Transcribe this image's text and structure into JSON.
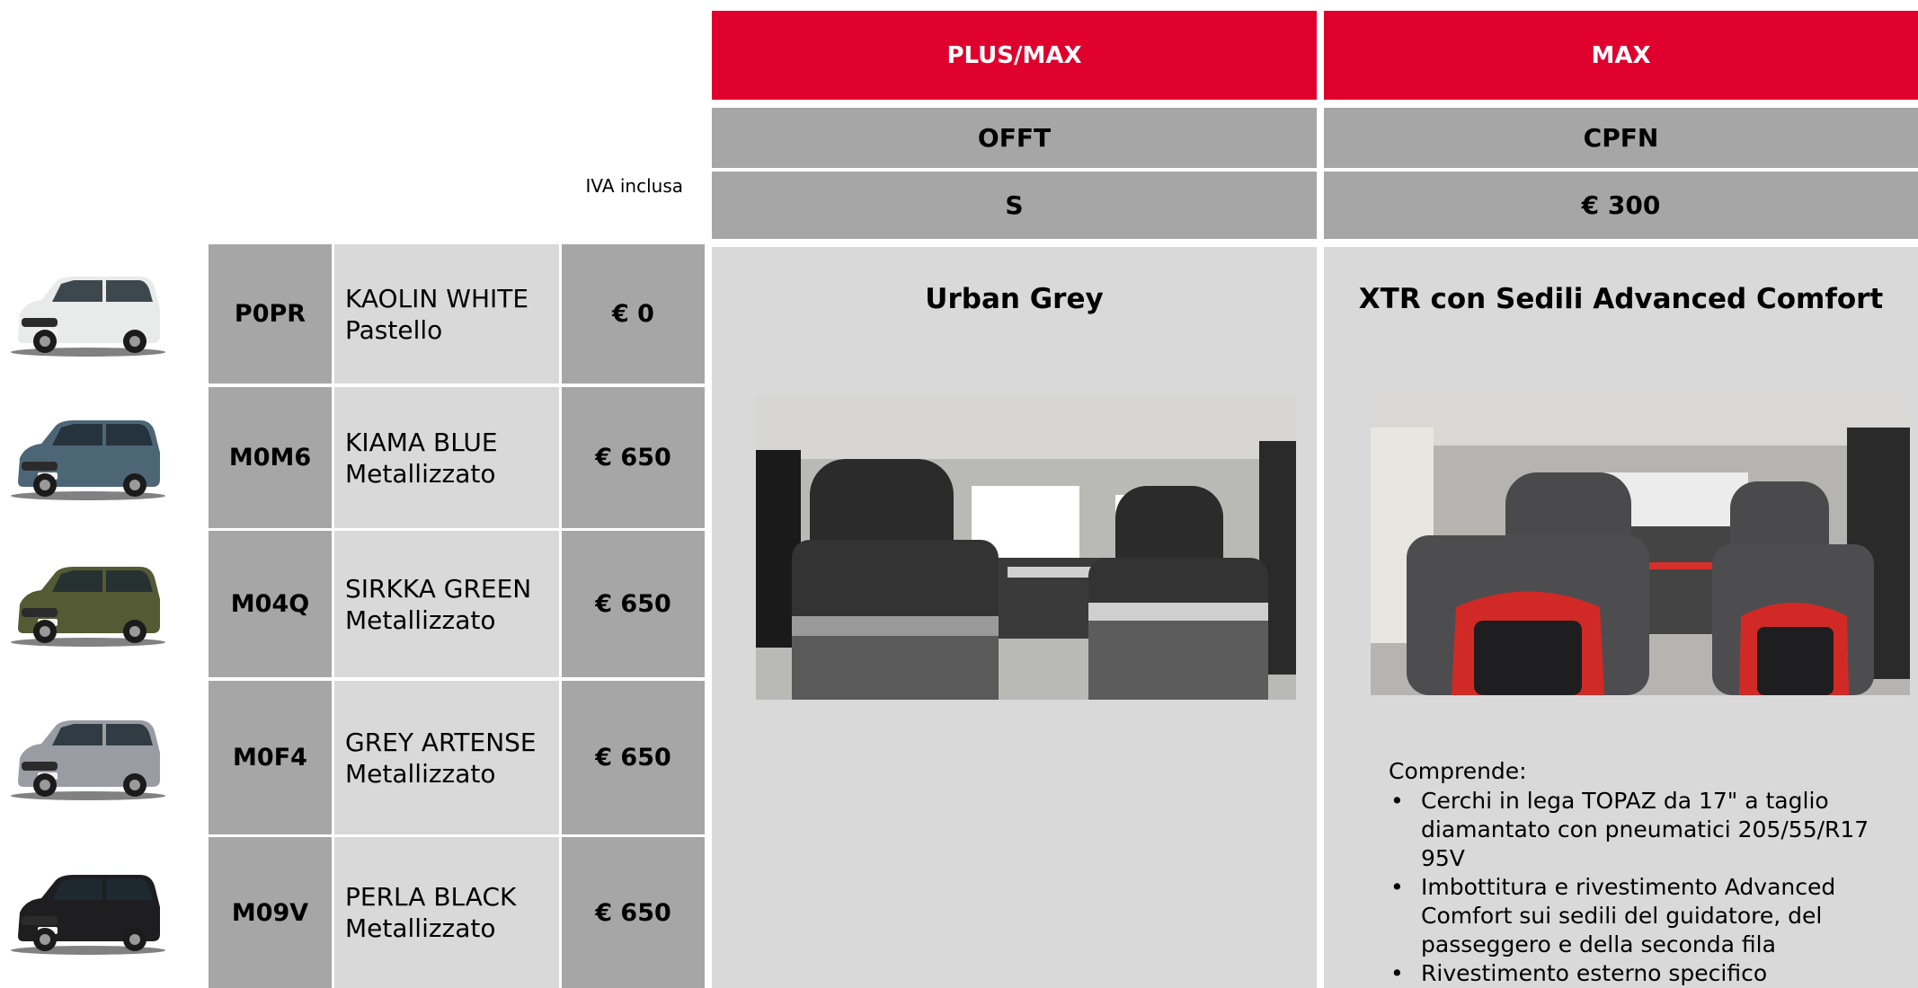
{
  "header": {
    "col1": {
      "trim": "PLUS/MAX",
      "code": "OFFT",
      "price": "S"
    },
    "col2": {
      "trim": "MAX",
      "code": "CPFN",
      "price": "€ 300"
    },
    "iva_note": "IVA inclusa"
  },
  "colors": [
    {
      "code": "P0PR",
      "name": "KAOLIN WHITE",
      "finish": "Pastello",
      "price": "€ 0",
      "paint": "#e9eaea"
    },
    {
      "code": "M0M6",
      "name": "KIAMA BLUE",
      "finish": "Metallizzato",
      "price": "€ 650",
      "paint": "#4d6676"
    },
    {
      "code": "M04Q",
      "name": "SIRKKA GREEN",
      "finish": "Metallizzato",
      "price": "€ 650",
      "paint": "#535a34"
    },
    {
      "code": "M0F4",
      "name": "GREY ARTENSE",
      "finish": "Metallizzato",
      "price": "€ 650",
      "paint": "#9a9ca4"
    },
    {
      "code": "M09V",
      "name": "PERLA BLACK",
      "finish": "Metallizzato",
      "price": "€ 650",
      "paint": "#1e1e20"
    }
  ],
  "panels": {
    "left": {
      "title": "Urban Grey"
    },
    "right": {
      "title": "XTR con Sedili Advanced Comfort",
      "includes_heading": "Comprende:",
      "includes": [
        "Cerchi in lega TOPAZ da 17\" a taglio diamantato con pneumatici 205/55/R17 95V",
        "Imbottitura e rivestimento Advanced Comfort sui sedili del guidatore, del passeggero e della seconda fila",
        "Rivestimento esterno specifico"
      ]
    }
  },
  "theme": {
    "accent": "#e0002e",
    "header_grey": "#a6a6a6",
    "cell_light": "#d9d9d9"
  }
}
